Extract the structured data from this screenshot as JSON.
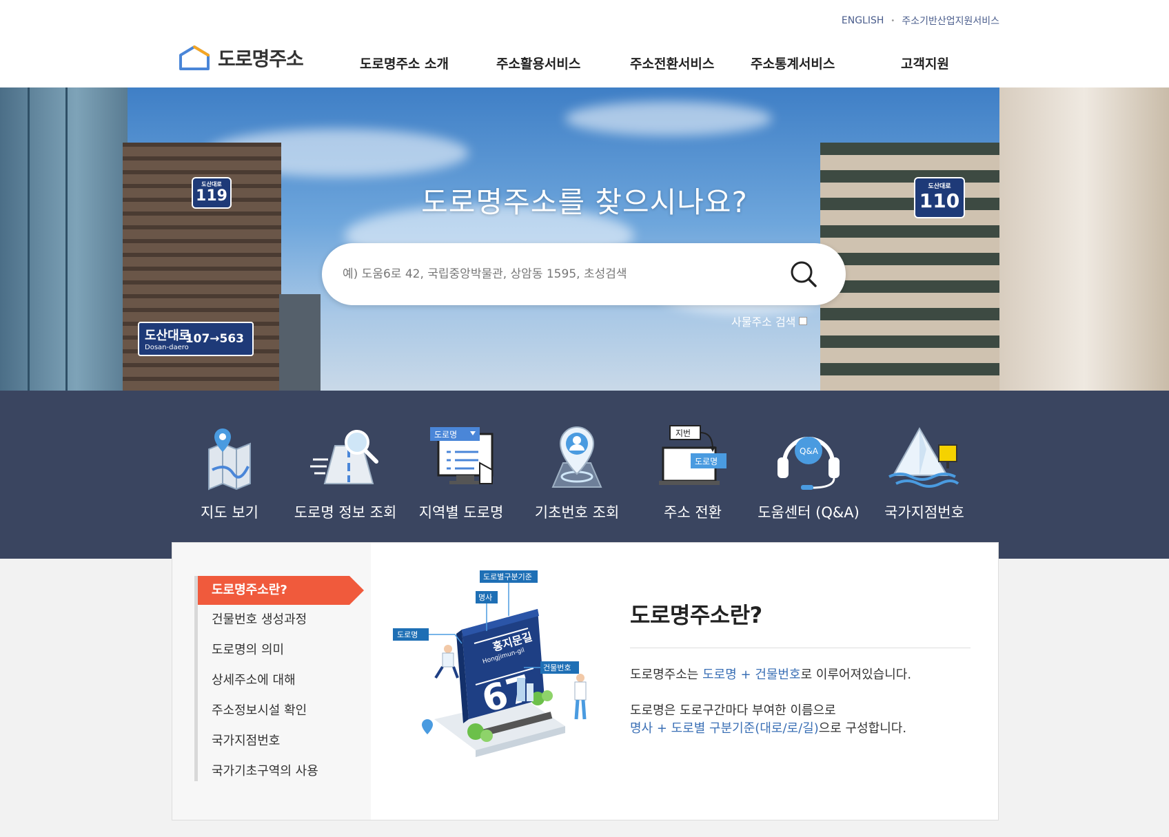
{
  "util": {
    "english": "ENGLISH",
    "industry": "주소기반산업지원서비스"
  },
  "logo": {
    "text": "도로명주소"
  },
  "gnb": [
    "도로명주소 소개",
    "주소활용서비스",
    "주소전환서비스",
    "주소통계서비스",
    "고객지원"
  ],
  "hero": {
    "title": "도로명주소를 찾으시나요?",
    "search_placeholder": "예) 도움6로 42, 국립중앙박물관, 상암동 1595, 초성검색",
    "business_search_label": "사물주소 검색",
    "signs": {
      "left_top_small": "도산대로",
      "left_top_num": "119",
      "left_road_name": "도산대로",
      "left_road_en": "Dosan-daero",
      "left_road_num": "107→563",
      "right_small": "도산대로",
      "right_num": "110"
    }
  },
  "quick": [
    {
      "label": "지도 보기",
      "icon": "map-icon"
    },
    {
      "label": "도로명 정보 조회",
      "icon": "road-search-icon"
    },
    {
      "label": "지역별 도로명",
      "icon": "regional-road-icon"
    },
    {
      "label": "기초번호 조회",
      "icon": "location-pin-icon"
    },
    {
      "label": "주소 전환",
      "icon": "address-convert-icon"
    },
    {
      "label": "도움센터 (Q&A)",
      "icon": "headset-icon"
    },
    {
      "label": "국가지점번호",
      "icon": "mountain-point-icon"
    }
  ],
  "quick_tags": {
    "road": "도로명",
    "lot": "지번",
    "road2": "도로명",
    "qa": "Q&A"
  },
  "lnb": [
    "도로명주소란?",
    "건물번호 생성과정",
    "도로명의 의미",
    "상세주소에 대해",
    "주소정보시설 확인",
    "국가지점번호",
    "국가기초구역의 사용"
  ],
  "illus": {
    "tag_criteria": "도로별구분기준",
    "tag_noun": "명사",
    "tag_road": "도로명",
    "tag_building": "건물번호",
    "sign_name": "홍지문길",
    "sign_en": "Hongjimun-gil",
    "sign_num": "67"
  },
  "content": {
    "title": "도로명주소란?",
    "p1_pre": "도로명주소는 ",
    "p1_road": "도로명",
    "p1_plus": " + ",
    "p1_bnum": "건물번호",
    "p1_post": "로 이루어져있습니다.",
    "p2_line1": "도로명은 도로구간마다 부여한 이름으로",
    "p2_noun": "명사",
    "p2_plus": " + ",
    "p2_crit": "도로별 구분기준(대로/로/길)",
    "p2_post": "으로 구성합니다."
  },
  "colors": {
    "accent": "#f05a3c",
    "navy": "#3a4560",
    "link": "#3a6fb5"
  }
}
